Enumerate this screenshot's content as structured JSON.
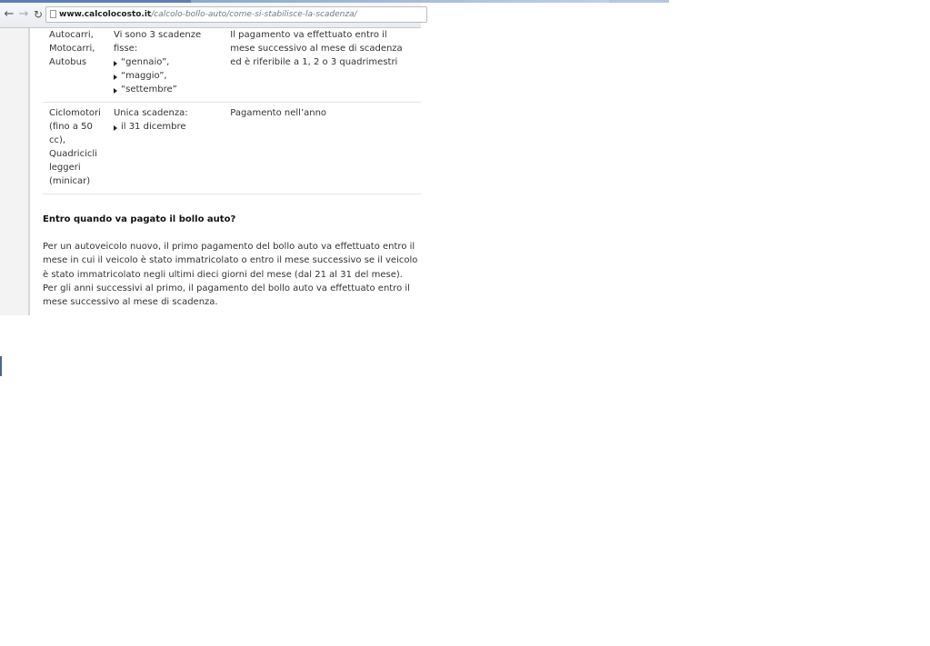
{
  "browser": {
    "url_host": "www.calcolocosto.it",
    "url_path": "/calcolo-bollo-auto/come-si-stabilisce-la-scadenza/"
  },
  "table": {
    "rows": [
      {
        "vehicle_lines": [
          "Autocarri,",
          "Motocarri,",
          "Autobus"
        ],
        "deadline_intro": "Vi sono 3 scadenze fisse:",
        "deadline_items": [
          "“gennaio”,",
          "“maggio”,",
          "“settembre”"
        ],
        "payment": "Il pagamento va effettuato entro il mese successivo al mese di scadenza ed è riferibile a 1, 2 o 3 quadrimestri"
      },
      {
        "vehicle_lines": [
          "Ciclomotori",
          "(fino a 50",
          "cc),",
          "Quadricicli",
          "leggeri",
          "(minicar)"
        ],
        "deadline_intro": "Unica scadenza:",
        "deadline_items": [
          "il 31 dicembre"
        ],
        "payment": "Pagamento nell’anno"
      }
    ]
  },
  "section": {
    "heading": "Entro quando va pagato il bollo auto?",
    "paragraph_1": "Per un autoveicolo nuovo,  il primo pagamento del bollo auto va effettuato entro il mese in cui il veicolo è stato immatricolato o  entro il mese successivo se il veicolo è stato immatricolato negli ultimi dieci giorni del mese (dal 21 al 31 del mese).",
    "paragraph_2": "Per gli anni successivi al primo, il pagamento del bollo auto va effettuato entro il mese successivo al mese di scadenza."
  }
}
